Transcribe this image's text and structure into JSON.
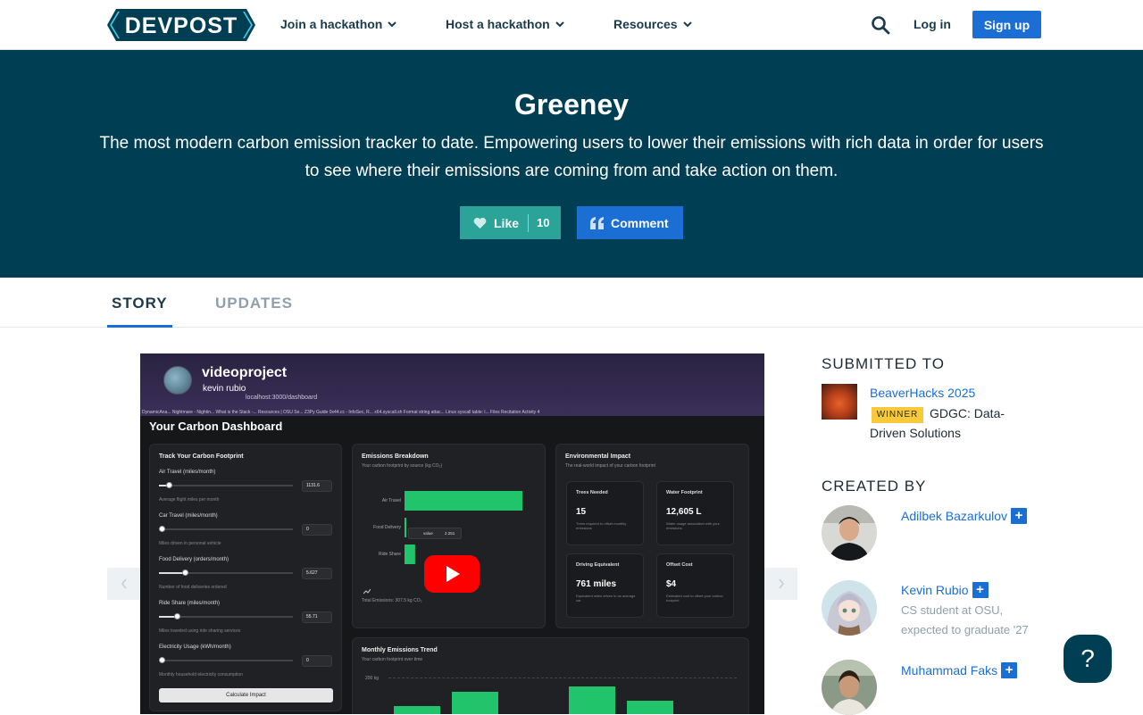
{
  "nav": {
    "logo_text": "DEVPOST",
    "menu": [
      "Join a hackathon",
      "Host a hackathon",
      "Resources"
    ],
    "login": "Log in",
    "signup": "Sign up"
  },
  "hero": {
    "title": "Greeney",
    "tagline": "The most modern carbon emission tracker to date. Empowering users to lower their emissions with rich data in order for users to see where their emissions are coming from and take action on them.",
    "like_label": "Like",
    "like_count": "10",
    "comment_label": "Comment"
  },
  "tabs": [
    "STORY",
    "UPDATES"
  ],
  "video": {
    "title": "videoproject",
    "channel": "kevin rubio",
    "url": "localhost:3000/dashboard",
    "bookmarks": "DynamicAna...  Nightmare - Nightin...  What is the Stack -...  Resources | OSU Se...  Z3Py Guide  0x44.cc - InfoSec, R...  x64.syscall.sh  Format string attac...  Linux syscall table: l...  Files  Recitation Activity 4",
    "dashboard_title": "Your Carbon Dashboard",
    "track": {
      "title": "Track Your Carbon Footprint",
      "fields": [
        {
          "label": "Air Travel (miles/month)",
          "value": "1131.6",
          "help": "Average flight miles per month",
          "fraction": 0.07
        },
        {
          "label": "Car Travel (miles/month)",
          "value": "0",
          "help": "Miles driven in personal vehicle",
          "fraction": 0
        },
        {
          "label": "Food Delivery (orders/month)",
          "value": "5.627",
          "help": "Number of food deliveries ordered",
          "fraction": 0.19
        },
        {
          "label": "Ride Share (miles/month)",
          "value": "55.71",
          "help": "Miles traveled using ride sharing services",
          "fraction": 0.13
        },
        {
          "label": "Electricity Usage (kWh/month)",
          "value": "0",
          "help": "Monthly household electricity consumption",
          "fraction": 0
        }
      ],
      "button": "Calculate Impact"
    },
    "breakdown": {
      "title": "Emissions Breakdown",
      "subtitle": "Your carbon footprint by source (kg CO₂)",
      "categories": [
        "Air Travel",
        "Food Delivery",
        "Ride Share"
      ],
      "values": [
        280,
        2.251,
        25.2
      ],
      "tooltip_label": "value",
      "tooltip_value": "2.251",
      "total": "Total Emissions: 307.5 kg CO₂"
    },
    "impact": {
      "title": "Environmental Impact",
      "subtitle": "The real-world impact of your carbon footprint",
      "cards": [
        {
          "title": "Trees Needed",
          "value": "15",
          "desc": "Trees required to offset monthly emissions"
        },
        {
          "title": "Water Footprint",
          "value": "12,605 L",
          "desc": "Water usage associated with your emissions"
        },
        {
          "title": "Driving Equivalent",
          "value": "761 miles",
          "desc": "Equivalent miles driven in an average car"
        },
        {
          "title": "Offset Cost",
          "value": "$4",
          "desc": "Estimated cost to offset your carbon footprint"
        }
      ]
    },
    "trend": {
      "title": "Monthly Emissions Trend",
      "subtitle": "Your carbon footprint over time",
      "y_tick": "200 kg"
    }
  },
  "sidebar": {
    "submitted_heading": "SUBMITTED TO",
    "hackathon": "BeaverHacks 2025",
    "badge": "WINNER",
    "prize_line1": "GDGC: Data-",
    "prize_line2": "Driven Solutions",
    "created_heading": "CREATED BY",
    "members": [
      {
        "name": "Adilbek Bazarkulov",
        "bio1": "",
        "bio2": ""
      },
      {
        "name": "Kevin Rubio",
        "bio1": "CS student at OSU,",
        "bio2": "expected to graduate '27"
      },
      {
        "name": "Muhammad Faks",
        "bio1": "",
        "bio2": ""
      }
    ]
  },
  "help": "?",
  "colors": {
    "brand_dark": "#003e54",
    "accent_blue": "#1a6ed4",
    "like_teal": "#2ba398",
    "winner_yellow": "#f8c93a"
  }
}
